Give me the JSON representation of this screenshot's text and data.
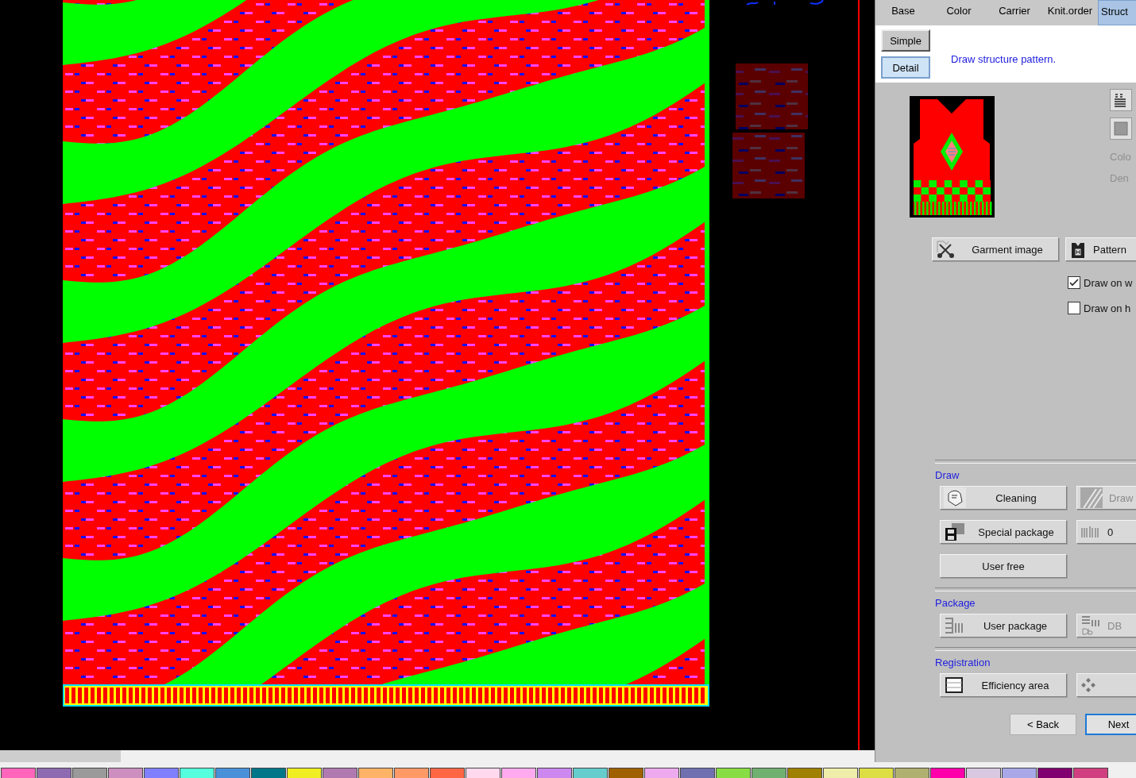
{
  "tabs": [
    {
      "label": "Base",
      "selected": false
    },
    {
      "label": "Color",
      "selected": false
    },
    {
      "label": "Carrier",
      "selected": false
    },
    {
      "label": "Knit.order",
      "selected": false
    },
    {
      "label": "Struct",
      "selected": true
    }
  ],
  "mode_buttons": [
    {
      "label": "Simple",
      "selected": false
    },
    {
      "label": "Detail",
      "selected": true
    }
  ],
  "hint": "Draw structure pattern.",
  "side_labels": [
    {
      "label": "Colo",
      "disabled": true
    },
    {
      "label": "Den",
      "disabled": true
    }
  ],
  "image_buttons": [
    {
      "label": "Garment image",
      "kind": "scissors"
    },
    {
      "label": "Pattern",
      "kind": "vest"
    }
  ],
  "checkboxes": [
    {
      "label": "Draw on w",
      "checked": true
    },
    {
      "label": "Draw on h",
      "checked": false
    }
  ],
  "sections": [
    {
      "title": "Draw",
      "buttons": [
        {
          "label": "Cleaning",
          "kind": "cleaning",
          "disabled": false
        },
        {
          "label": "Draw",
          "kind": "lines",
          "disabled": true
        },
        {
          "label": "Special package",
          "kind": "floppy",
          "disabled": false
        },
        {
          "label": "0",
          "kind": "barcode",
          "disabled": false
        },
        {
          "label": "User free",
          "kind": "plain",
          "disabled": false
        }
      ]
    },
    {
      "title": "Package",
      "buttons": [
        {
          "label": "User package",
          "kind": "package",
          "disabled": false
        },
        {
          "label": "DB",
          "kind": "db",
          "disabled": true
        }
      ]
    },
    {
      "title": "Registration",
      "buttons": [
        {
          "label": "Efficiency area",
          "kind": "frame",
          "disabled": false
        },
        {
          "kind": "checker"
        }
      ]
    }
  ],
  "nav_buttons": [
    {
      "label": "< Back",
      "focused": false
    },
    {
      "label": "Next",
      "focused": true
    }
  ],
  "palette": [
    {
      "color": "#ff66bb"
    },
    {
      "color": "#8e6bb0"
    },
    {
      "color": "#9a9a9a"
    },
    {
      "color": "#cc8fbf"
    },
    {
      "color": "#8080ff"
    },
    {
      "color": "#55ffdd"
    },
    {
      "color": "#4a90d9"
    },
    {
      "color": "#007788"
    },
    {
      "color": "#eeee22"
    },
    {
      "color": "#b07ab0"
    },
    {
      "color": "#ffb366"
    },
    {
      "color": "#ff9966"
    },
    {
      "color": "#ff6644"
    },
    {
      "color": "#ffd9ee"
    },
    {
      "color": "#ffaaee"
    },
    {
      "color": "#cc88ee"
    },
    {
      "color": "#66cccc"
    },
    {
      "color": "#a06000"
    },
    {
      "color": "#eeaaee"
    },
    {
      "color": "#7070b0"
    },
    {
      "color": "#88dd44"
    },
    {
      "color": "#70b070"
    },
    {
      "color": "#a08000"
    },
    {
      "color": "#eeeeaa"
    },
    {
      "color": "#dddd44"
    },
    {
      "color": "#b0b070"
    },
    {
      "color": "#ff00aa"
    },
    {
      "color": "#d8c8e0"
    },
    {
      "color": "#a8a8e8"
    },
    {
      "color": "#800070"
    },
    {
      "color": "#d04080"
    }
  ]
}
